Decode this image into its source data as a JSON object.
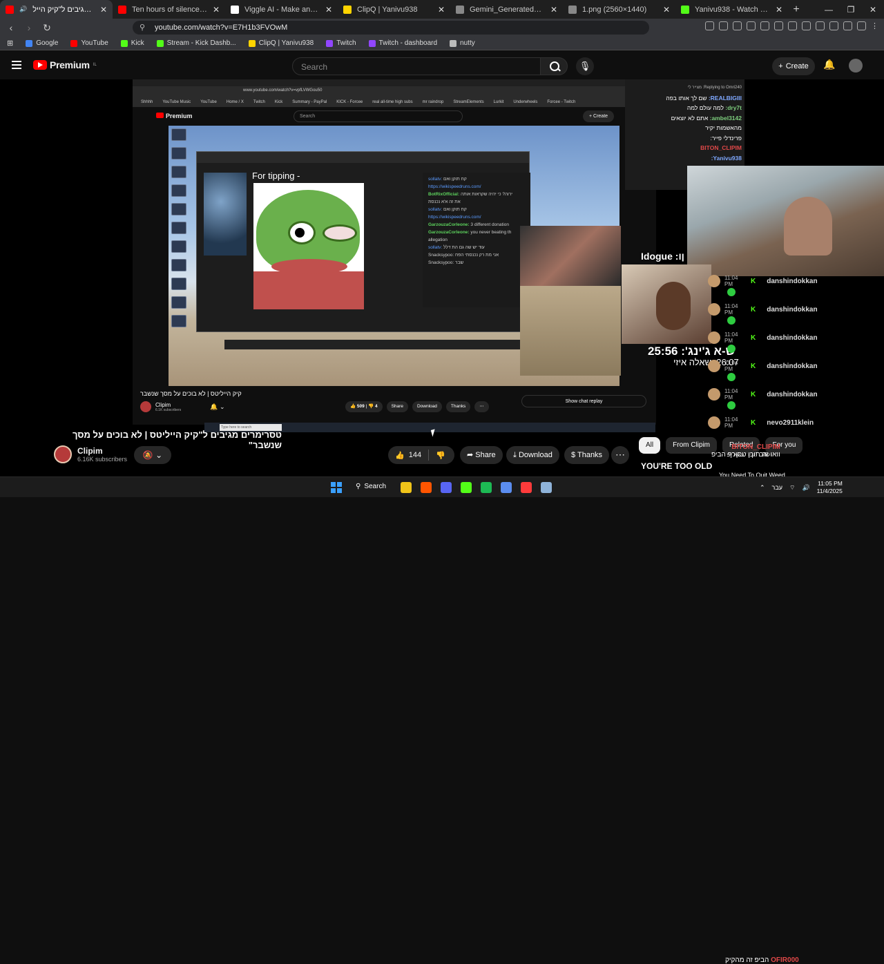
{
  "browser": {
    "tabs": [
      {
        "title": "טסרימרים מגיבים ל\"קיק הייל",
        "color": "#ff0000",
        "active": true
      },
      {
        "title": "Ten hours of silence occasionally bro",
        "color": "#ff0000"
      },
      {
        "title": "Viggle AI - Make any character move",
        "color": "#ffffff"
      },
      {
        "title": "ClipQ | Yanivu938",
        "color": "#ffd400"
      },
      {
        "title": "Gemini_Generated_Image_cesxvxces",
        "color": "#888888"
      },
      {
        "title": "1.png (2560×1440)",
        "color": "#888888"
      },
      {
        "title": "Yanivu938 - Watch clips on Kick",
        "color": "#53fc18"
      }
    ],
    "url": "youtube.com/watch?v=E7H1b3FVOwM",
    "bookmarks": [
      {
        "label": "Google",
        "color": "#4285f4"
      },
      {
        "label": "YouTube",
        "color": "#ff0000"
      },
      {
        "label": "Kick",
        "color": "#53fc18"
      },
      {
        "label": "Stream - Kick Dashb...",
        "color": "#53fc18"
      },
      {
        "label": "ClipQ | Yanivu938",
        "color": "#ffd400"
      },
      {
        "label": "Twitch",
        "color": "#9146ff"
      },
      {
        "label": "Twitch - dashboard",
        "color": "#9146ff"
      },
      {
        "label": "nutty",
        "color": "#bbbbbb"
      }
    ]
  },
  "youtube": {
    "brand": "Premium",
    "brand_sup": "IL",
    "search_placeholder": "Search",
    "create_label": "Create"
  },
  "inner_video": {
    "url": "www.youtube.com/watch?v=vpfLVWGou50",
    "bookmarks": [
      "Shhhh",
      "YouTube Music",
      "YouTube",
      "Home / X",
      "Twitch",
      "Kick",
      "Summary - PayPal",
      "KICK - Forcee",
      "real all-time high subs",
      "mr raindrop",
      "StreamElements",
      "Lurkit",
      "Underwheels",
      "Forcee - Twitch"
    ],
    "brand": "Premium",
    "search": "Search",
    "create": "Create",
    "tip_text": "For tipping -",
    "chat_lines": [
      {
        "user": "sollatv:",
        "text": "קח תוקן ואם",
        "cls": "l"
      },
      {
        "user": "",
        "text": "https://wikispeedruns.com/",
        "cls": "l"
      },
      {
        "user": "BotRixOfficial:",
        "text": "ירוה? כי יהיה שקראות אותה",
        "cls": "g"
      },
      {
        "user": "",
        "text": "את זה א'א נכנסת",
        "cls": ""
      },
      {
        "user": "sollatv:",
        "text": "קח תוקן ואם",
        "cls": "l"
      },
      {
        "user": "",
        "text": "https://wikispeedruns.com/",
        "cls": "l"
      },
      {
        "user": "GarzouzaCorleone:",
        "text": "3 different donation",
        "cls": "g"
      },
      {
        "user": "GarzouzaCorleone:",
        "text": "you never beating th",
        "cls": "g"
      },
      {
        "user": "",
        "text": "allegation",
        "cls": ""
      },
      {
        "user": "sollatv:",
        "text": "עוד יש שה גם הת דלל",
        "cls": "l"
      },
      {
        "user": "Snacksypoo:",
        "text": "אני מת רק נכנסתי הפח",
        "cls": ""
      },
      {
        "user": "Snacksypoo:",
        "text": "שבר",
        "cls": ""
      }
    ],
    "taskbar_search": "Type here to search",
    "title": "קיק הייליטס | לא בוכים על מסך שנשבר",
    "channel": "Clipim",
    "subs": "6.1K subscribers",
    "likes": "509",
    "dislikes": "4",
    "share": "Share",
    "download": "Download",
    "thanks": "Thanks",
    "show_chat_replay": "Show chat replay"
  },
  "overlay_chat": {
    "lines": [
      {
        "user": "",
        "text": "Replying to Omri240: מצייר לי",
        "cls": "small"
      },
      {
        "user": "REALBIGIII:",
        "text": "שם לך אותו בפה",
        "cls": "y"
      },
      {
        "user": "dry7t:",
        "text": "למה עולם למה",
        "cls": "u"
      },
      {
        "user": "ambel3142:",
        "text": "אתם לא יוצאים",
        "cls": "u"
      },
      {
        "user": "",
        "text": "מהאשמות יקיר",
        "cls": ""
      },
      {
        "user": "פרינדלי פייר:",
        "text": "",
        "cls": ""
      },
      {
        "user": "BITON_CLIPIM",
        "text": "",
        "cls": "r"
      },
      {
        "user": "Yanivu938:",
        "text": "",
        "cls": "y"
      },
      {
        "user": "OFIR000",
        "text": "",
        "cls": "r"
      },
      {
        "user": "ambel3142:",
        "text": "אני",
        "cls": "u"
      },
      {
        "user": "",
        "text": "מתתתתתתתתתת",
        "cls": ""
      }
    ],
    "overlay_name": "Idogue :ןו",
    "timer1": "ש-א ג'ינג': 25:56",
    "timer2": "26:07 :שאלה איזי"
  },
  "kick_feed": [
    {
      "time": "11:04 PM",
      "user": "danshindokkan"
    },
    {
      "time": "11:04 PM",
      "user": "danshindokkan"
    },
    {
      "time": "11:04 PM",
      "user": "danshindokkan"
    },
    {
      "time": "11:04 PM",
      "user": "danshindokkan"
    },
    {
      "time": "11:04 PM",
      "user": "danshindokkan"
    },
    {
      "time": "11:04 PM",
      "user": "nevo2911klein"
    }
  ],
  "kick_extra": "ושוב יקיר בקליפ",
  "video": {
    "title": "טסרימרים מגיבים ל\"קיק הייליטס | לא בוכים על מסך שנשבר\"",
    "channel": "Clipim",
    "subs": "6.16K subscribers",
    "likes": "144",
    "share": "Share",
    "download": "Download",
    "thanks": "Thanks"
  },
  "chips": [
    "All",
    "From Clipim",
    "Related",
    "For you"
  ],
  "late_chat": {
    "user": "BITON_CLIPIM",
    "line1": "וואו זה תוכן טסורף הביפ",
    "banner": "YOU'RE TOO OLD",
    "quit": "You Need To Quit Weed.",
    "user2": "OFIR000",
    "line2": "הביפ זה מהקיק"
  },
  "taskbar": {
    "search": "Search",
    "lang": "עבר",
    "time": "11:05 PM",
    "date": "11/4/2025",
    "icon_colors": [
      "#f0c419",
      "#ff5500",
      "#5865f2",
      "#53fc18",
      "#1db954",
      "#5b8def",
      "#ff3b3b",
      "#8fb3d9"
    ]
  }
}
